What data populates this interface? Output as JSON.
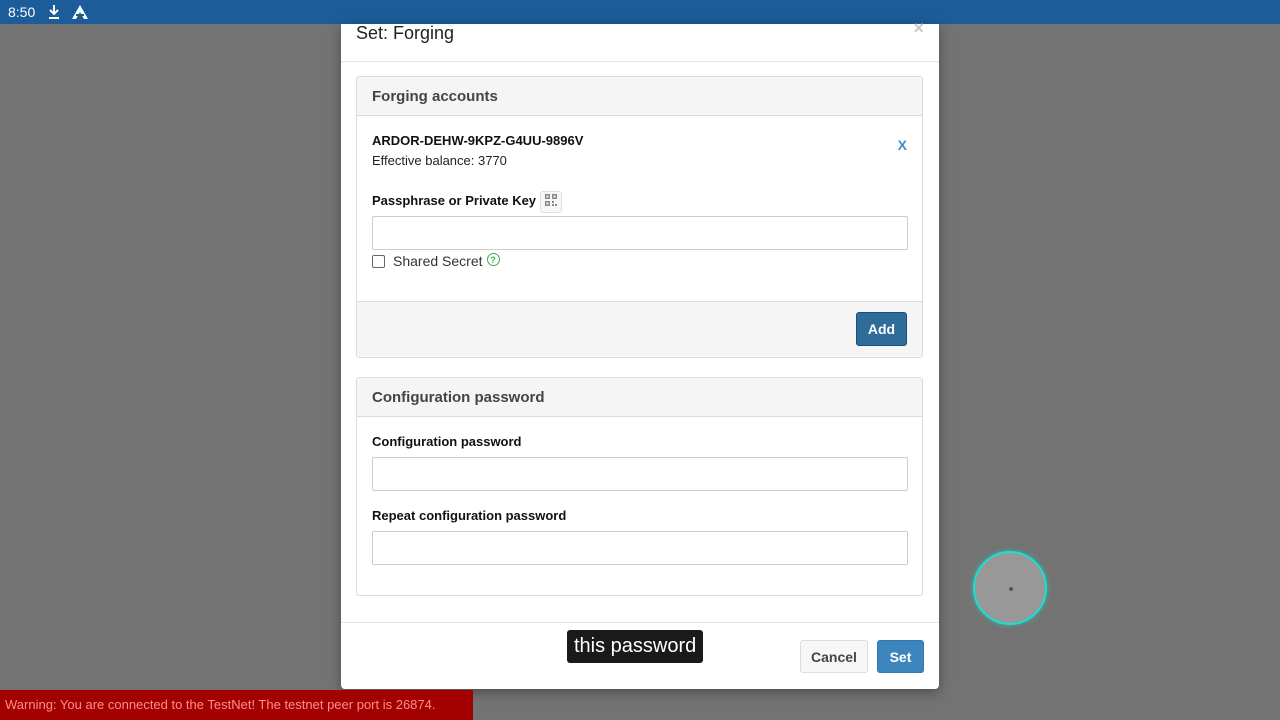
{
  "statusbar": {
    "time": "8:50",
    "icons": [
      "download-icon",
      "app-logo-icon"
    ]
  },
  "modal": {
    "title": "Set: Forging",
    "close_label": "×"
  },
  "forging_panel": {
    "heading": "Forging accounts",
    "account_id": "ARDOR-DEHW-9KPZ-G4UU-9896V",
    "effective_balance": "Effective balance: 3770",
    "remove_label": "X",
    "passphrase_label": "Passphrase or Private Key",
    "passphrase_value": "",
    "shared_secret_label": "Shared Secret",
    "help_glyph": "?",
    "add_label": "Add"
  },
  "config_panel": {
    "heading": "Configuration password",
    "password_label": "Configuration password",
    "password_value": "",
    "repeat_label": "Repeat configuration password",
    "repeat_value": ""
  },
  "footer": {
    "cancel_label": "Cancel",
    "set_label": "Set"
  },
  "caption": "this password",
  "warning": "Warning: You are connected to the TestNet! The testnet peer port is 26874.",
  "colors": {
    "statusbar": "#1c5d99",
    "primary_button": "#2e6c9a",
    "set_button": "#3d86bd",
    "warning_bg": "#a30000",
    "touch_ring": "#19e0d0"
  }
}
